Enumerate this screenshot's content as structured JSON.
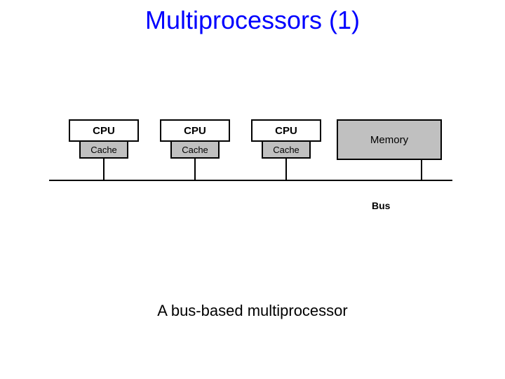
{
  "title": "Multiprocessors (1)",
  "blocks": {
    "cpu1": "CPU",
    "cpu2": "CPU",
    "cpu3": "CPU",
    "cache1": "Cache",
    "cache2": "Cache",
    "cache3": "Cache",
    "memory": "Memory"
  },
  "bus_label": "Bus",
  "caption": "A bus-based multiprocessor"
}
